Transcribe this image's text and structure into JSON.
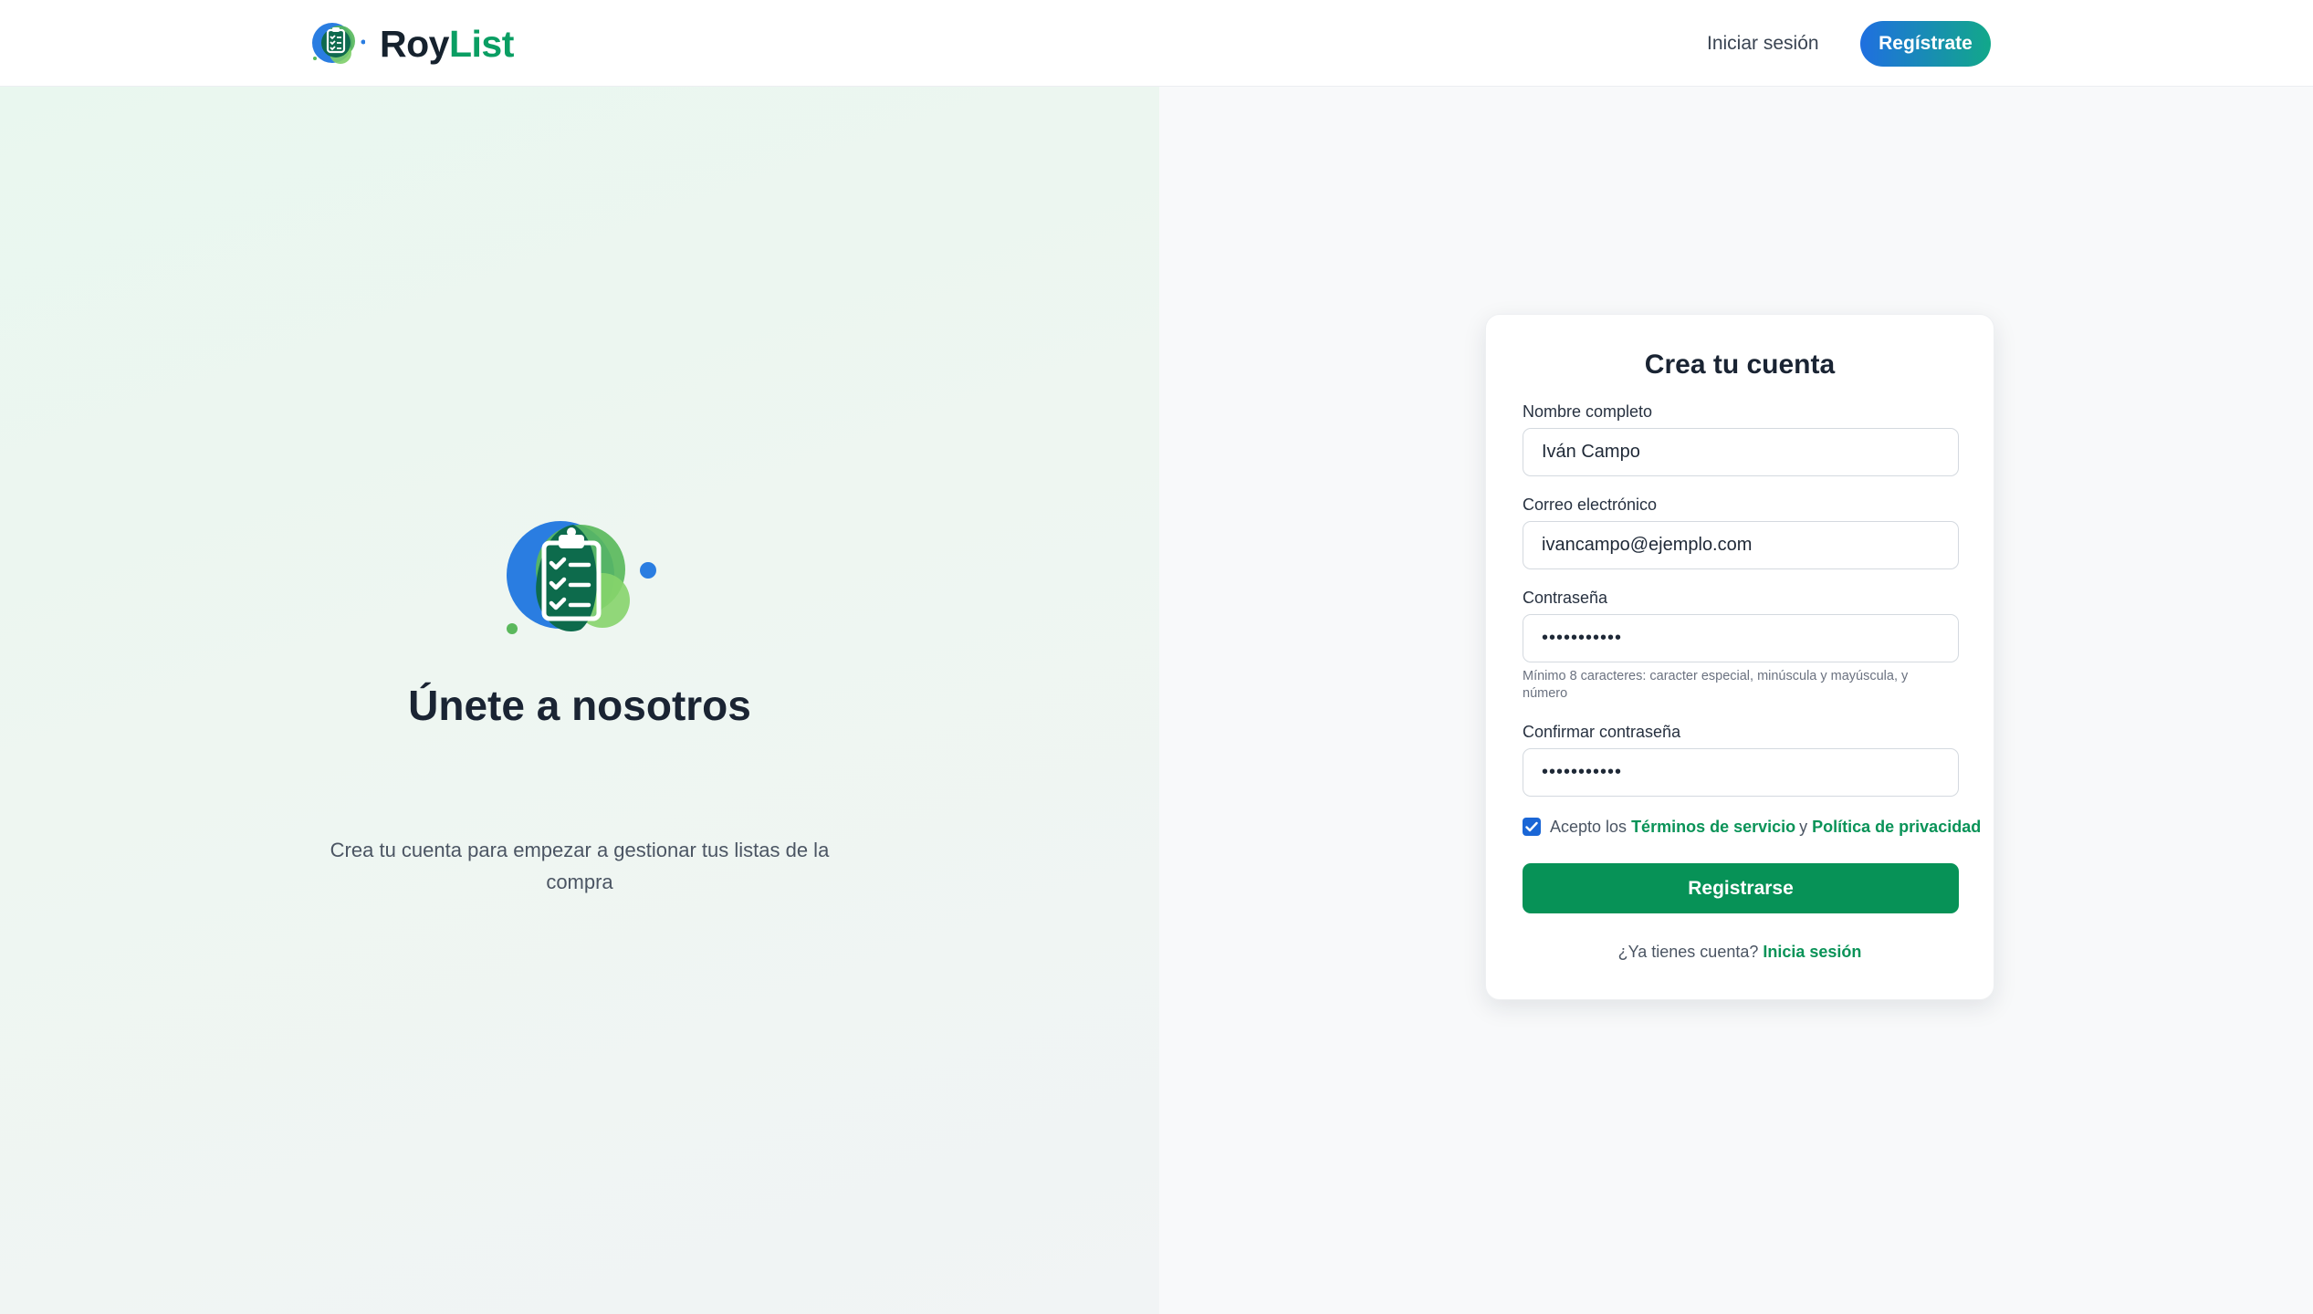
{
  "header": {
    "brand": {
      "part1": "Roy",
      "part2": "List",
      "logo_icon": "clipboard-check-icon"
    },
    "login_link": "Iniciar sesión",
    "register_button": "Regístrate"
  },
  "hero": {
    "illustration_icon": "clipboard-check-icon",
    "title": "Únete a nosotros",
    "subtitle_line1": "Crea tu cuenta para empezar a gestionar tus listas de la",
    "subtitle_line2": "compra"
  },
  "form": {
    "title": "Crea tu cuenta",
    "name": {
      "label": "Nombre completo",
      "value": "Iván Campo"
    },
    "email": {
      "label": "Correo electrónico",
      "value": "ivancampo@ejemplo.com"
    },
    "password": {
      "label": "Contraseña",
      "value": "•••••••••••",
      "hint_line1": "Mínimo 8 caracteres: caracter especial, minúscula y mayúscula, y",
      "hint_line2": "número"
    },
    "confirm_password": {
      "label": "Confirmar contraseña",
      "value": "•••••••••••"
    },
    "terms": {
      "checked": true,
      "prefix": "Acepto los",
      "terms_link": "Términos de servicio",
      "conjunction": "y",
      "privacy_link": "Política de privacidad"
    },
    "submit_button": "Registrarse",
    "footer": {
      "question": "¿Ya tienes cuenta?",
      "login_link": "Inicia sesión"
    }
  },
  "colors": {
    "brand_green": "#0a9e63",
    "primary_blue": "#1a66d6",
    "submit_green": "#079257",
    "link_green": "#0a9358"
  }
}
